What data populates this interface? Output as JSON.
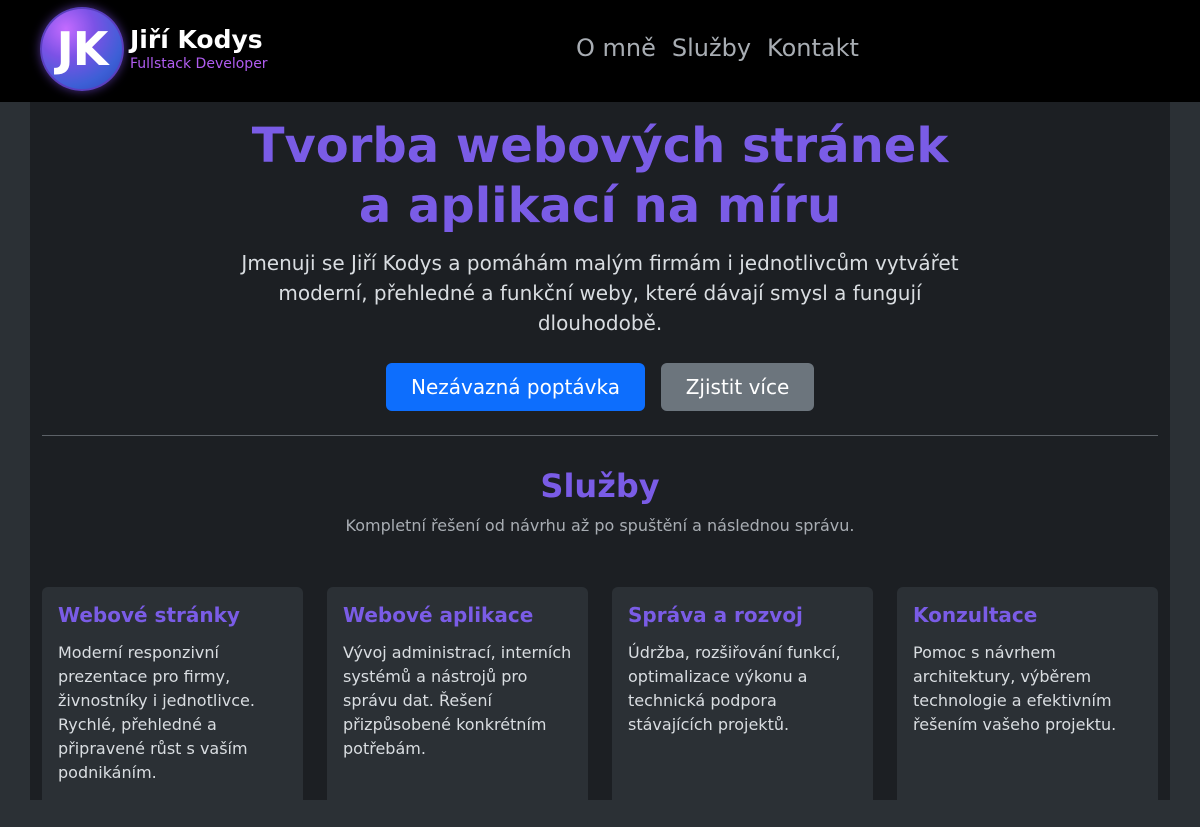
{
  "header": {
    "logo_initials": "JK",
    "brand_name": "Jiří Kodys",
    "brand_role": "Fullstack Developer",
    "nav": [
      {
        "label": "O mně"
      },
      {
        "label": "Služby"
      },
      {
        "label": "Kontakt"
      }
    ]
  },
  "hero": {
    "title_line1": "Tvorba webových stránek",
    "title_line2": "a aplikací na míru",
    "text": "Jmenuji se Jiří Kodys a pomáhám malým firmám i jednotlivcům vytvářet moderní, přehledné a funkční weby, které dávají smysl a fungují dlouhodobě.",
    "primary_button": "Nezávazná poptávka",
    "secondary_button": "Zjistit více"
  },
  "services": {
    "title": "Služby",
    "subtitle": "Kompletní řešení od návrhu až po spuštění a následnou správu.",
    "cards": [
      {
        "title": "Webové stránky",
        "text": "Moderní responzivní prezentace pro firmy, živnostníky i jednotlivce. Rychlé, přehledné a připravené růst s vaším podnikáním."
      },
      {
        "title": "Webové aplikace",
        "text": "Vývoj administrací, interních systémů a nástrojů pro správu dat. Řešení přizpůsobené konkrétním potřebám."
      },
      {
        "title": "Správa a rozvoj",
        "text": "Údržba, rozšiřování funkcí, optimalizace výkonu a technická podpora stávajících projektů."
      },
      {
        "title": "Konzultace",
        "text": "Pomoc s návrhem architektury, výběrem technologie a efektivním řešením vašeho projektu."
      }
    ]
  },
  "colors": {
    "accent": "#7a5ce6",
    "primary_button": "#0d6efd",
    "secondary_button": "#6c757d",
    "header_bg": "#000000",
    "page_bg": "#1c1f23",
    "card_bg": "#2b3035"
  }
}
